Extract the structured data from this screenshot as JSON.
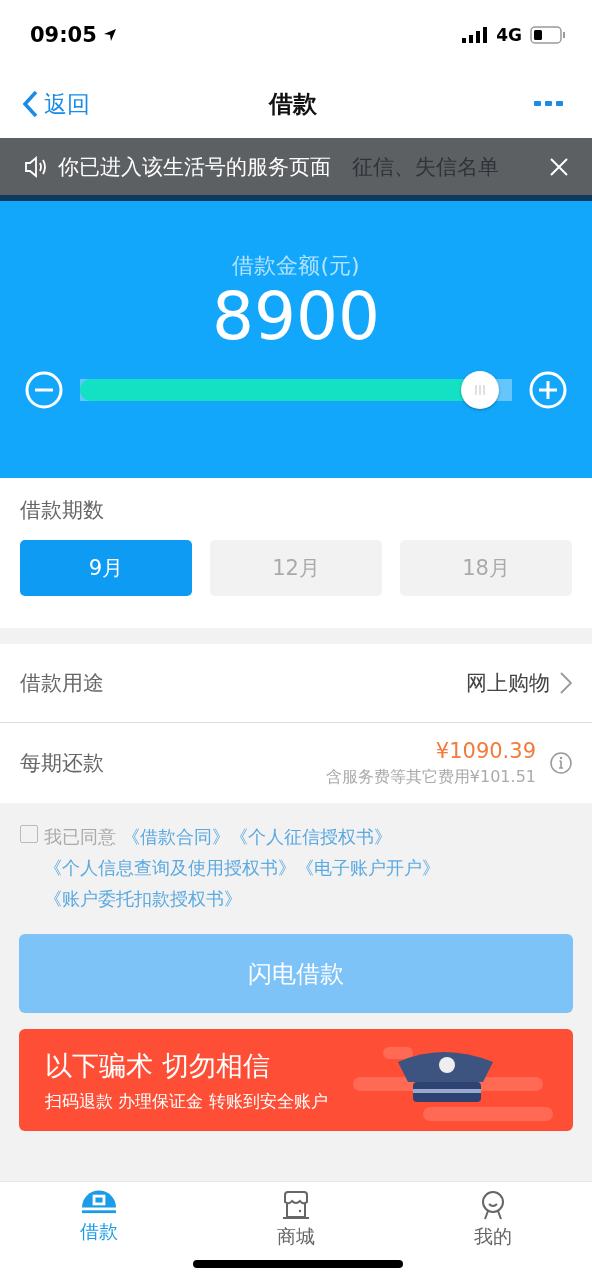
{
  "status_bar": {
    "time": "09:05",
    "network": "4G"
  },
  "nav": {
    "back": "返回",
    "title": "借款"
  },
  "notice": {
    "banner_text": "征信、失信名单",
    "toast": "你已进入该生活号的服务页面"
  },
  "amount": {
    "label": "借款金额(元)",
    "value": "8900",
    "level": 0.97
  },
  "terms": {
    "label": "借款期数",
    "options": [
      {
        "label": "9月",
        "selected": true
      },
      {
        "label": "12月",
        "selected": false
      },
      {
        "label": "18月",
        "selected": false
      }
    ]
  },
  "purpose": {
    "label": "借款用途",
    "value": "网上购物"
  },
  "repayment": {
    "label": "每期还款",
    "amount": "¥1090.39",
    "note": "含服务费等其它费用¥101.51"
  },
  "agreement": {
    "checked": false,
    "text": "我已同意",
    "links": [
      "《借款合同》",
      "《个人征信授权书》",
      "《个人信息查询及使用授权书》",
      "《电子账户开户》",
      "《账户委托扣款授权书》"
    ]
  },
  "submit": {
    "label": "闪电借款",
    "disabled": true
  },
  "warning": {
    "title": "以下骗术 切勿相信",
    "subtitle": "扫码退款 办理保证金 转账到安全账户"
  },
  "tabs": [
    {
      "label": "借款",
      "kind": "loan",
      "selected": true
    },
    {
      "label": "商城",
      "kind": "shop",
      "selected": false
    },
    {
      "label": "我的",
      "kind": "me",
      "selected": false
    }
  ]
}
